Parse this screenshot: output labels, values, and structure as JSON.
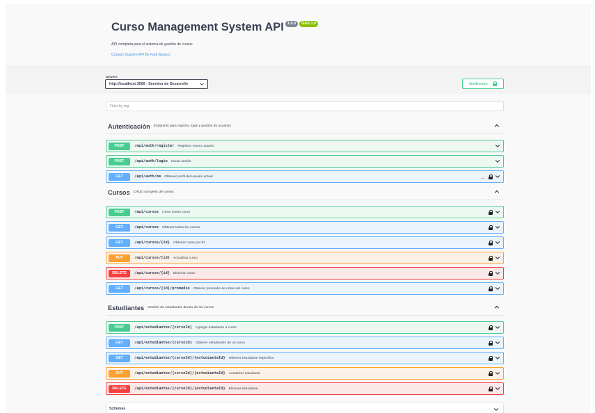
{
  "info": {
    "title": "Curso Management System API",
    "version_badge": "1.0.0",
    "oas_badge": "OAS 3.0",
    "description": "API completa para el sistema de gestión de cursos",
    "contact_link": "Contact Soporte API By Fadi Basaco"
  },
  "servers": {
    "label": "Servers",
    "selected": "http://localhost:3000 - Servidor de Desarrollo"
  },
  "authorize": {
    "label": "Authorize"
  },
  "filter": {
    "placeholder": "Filter by tag"
  },
  "tags": [
    {
      "name": "Autenticación",
      "description": "Endpoints para registro, login y gestión de usuarios",
      "operations": [
        {
          "method": "POST",
          "path": "/api/auth/register",
          "summary": "Registrar nuevo usuario"
        },
        {
          "method": "POST",
          "path": "/api/auth/login",
          "summary": "Iniciar sesión"
        },
        {
          "method": "GET",
          "path": "/api/auth/me",
          "summary": "Obtener perfil del usuario actual"
        }
      ]
    },
    {
      "name": "Cursos",
      "description": "CRUD completo de cursos",
      "operations": [
        {
          "method": "POST",
          "path": "/api/cursos",
          "summary": "Crear nuevo curso"
        },
        {
          "method": "GET",
          "path": "/api/cursos",
          "summary": "Obtener todos los cursos"
        },
        {
          "method": "GET",
          "path": "/api/cursos/{id}",
          "summary": "Obtener curso por ID"
        },
        {
          "method": "PUT",
          "path": "/api/cursos/{id}",
          "summary": "Actualizar curso"
        },
        {
          "method": "DELETE",
          "path": "/api/cursos/{id}",
          "summary": "Eliminar curso"
        },
        {
          "method": "GET",
          "path": "/api/cursos/{id}/promedio",
          "summary": "Obtener promedio de notas del curso"
        }
      ]
    },
    {
      "name": "Estudiantes",
      "description": "Gestión de estudiantes dentro de los cursos",
      "operations": [
        {
          "method": "POST",
          "path": "/api/estudiantes/{cursoId}",
          "summary": "Agregar estudiante a curso"
        },
        {
          "method": "GET",
          "path": "/api/estudiantes/{cursoId}",
          "summary": "Obtener estudiantes de un curso"
        },
        {
          "method": "GET",
          "path": "/api/estudiantes/{cursoId}/{estudianteId}",
          "summary": "Obtener estudiante específico"
        },
        {
          "method": "PUT",
          "path": "/api/estudiantes/{cursoId}/{estudianteId}",
          "summary": "Actualizar estudiante"
        },
        {
          "method": "DELETE",
          "path": "/api/estudiantes/{cursoId}/{estudianteId}",
          "summary": "Eliminar estudiante"
        }
      ]
    }
  ],
  "schemas": {
    "label": "Schemas"
  },
  "colors": {
    "post": "#49cc90",
    "get": "#61affe",
    "put": "#fca130",
    "delete": "#f93e3e"
  },
  "icons": {
    "lock": "lock-icon",
    "chevron_down": "chevron-down-icon",
    "chevron_up": "chevron-up-icon"
  }
}
